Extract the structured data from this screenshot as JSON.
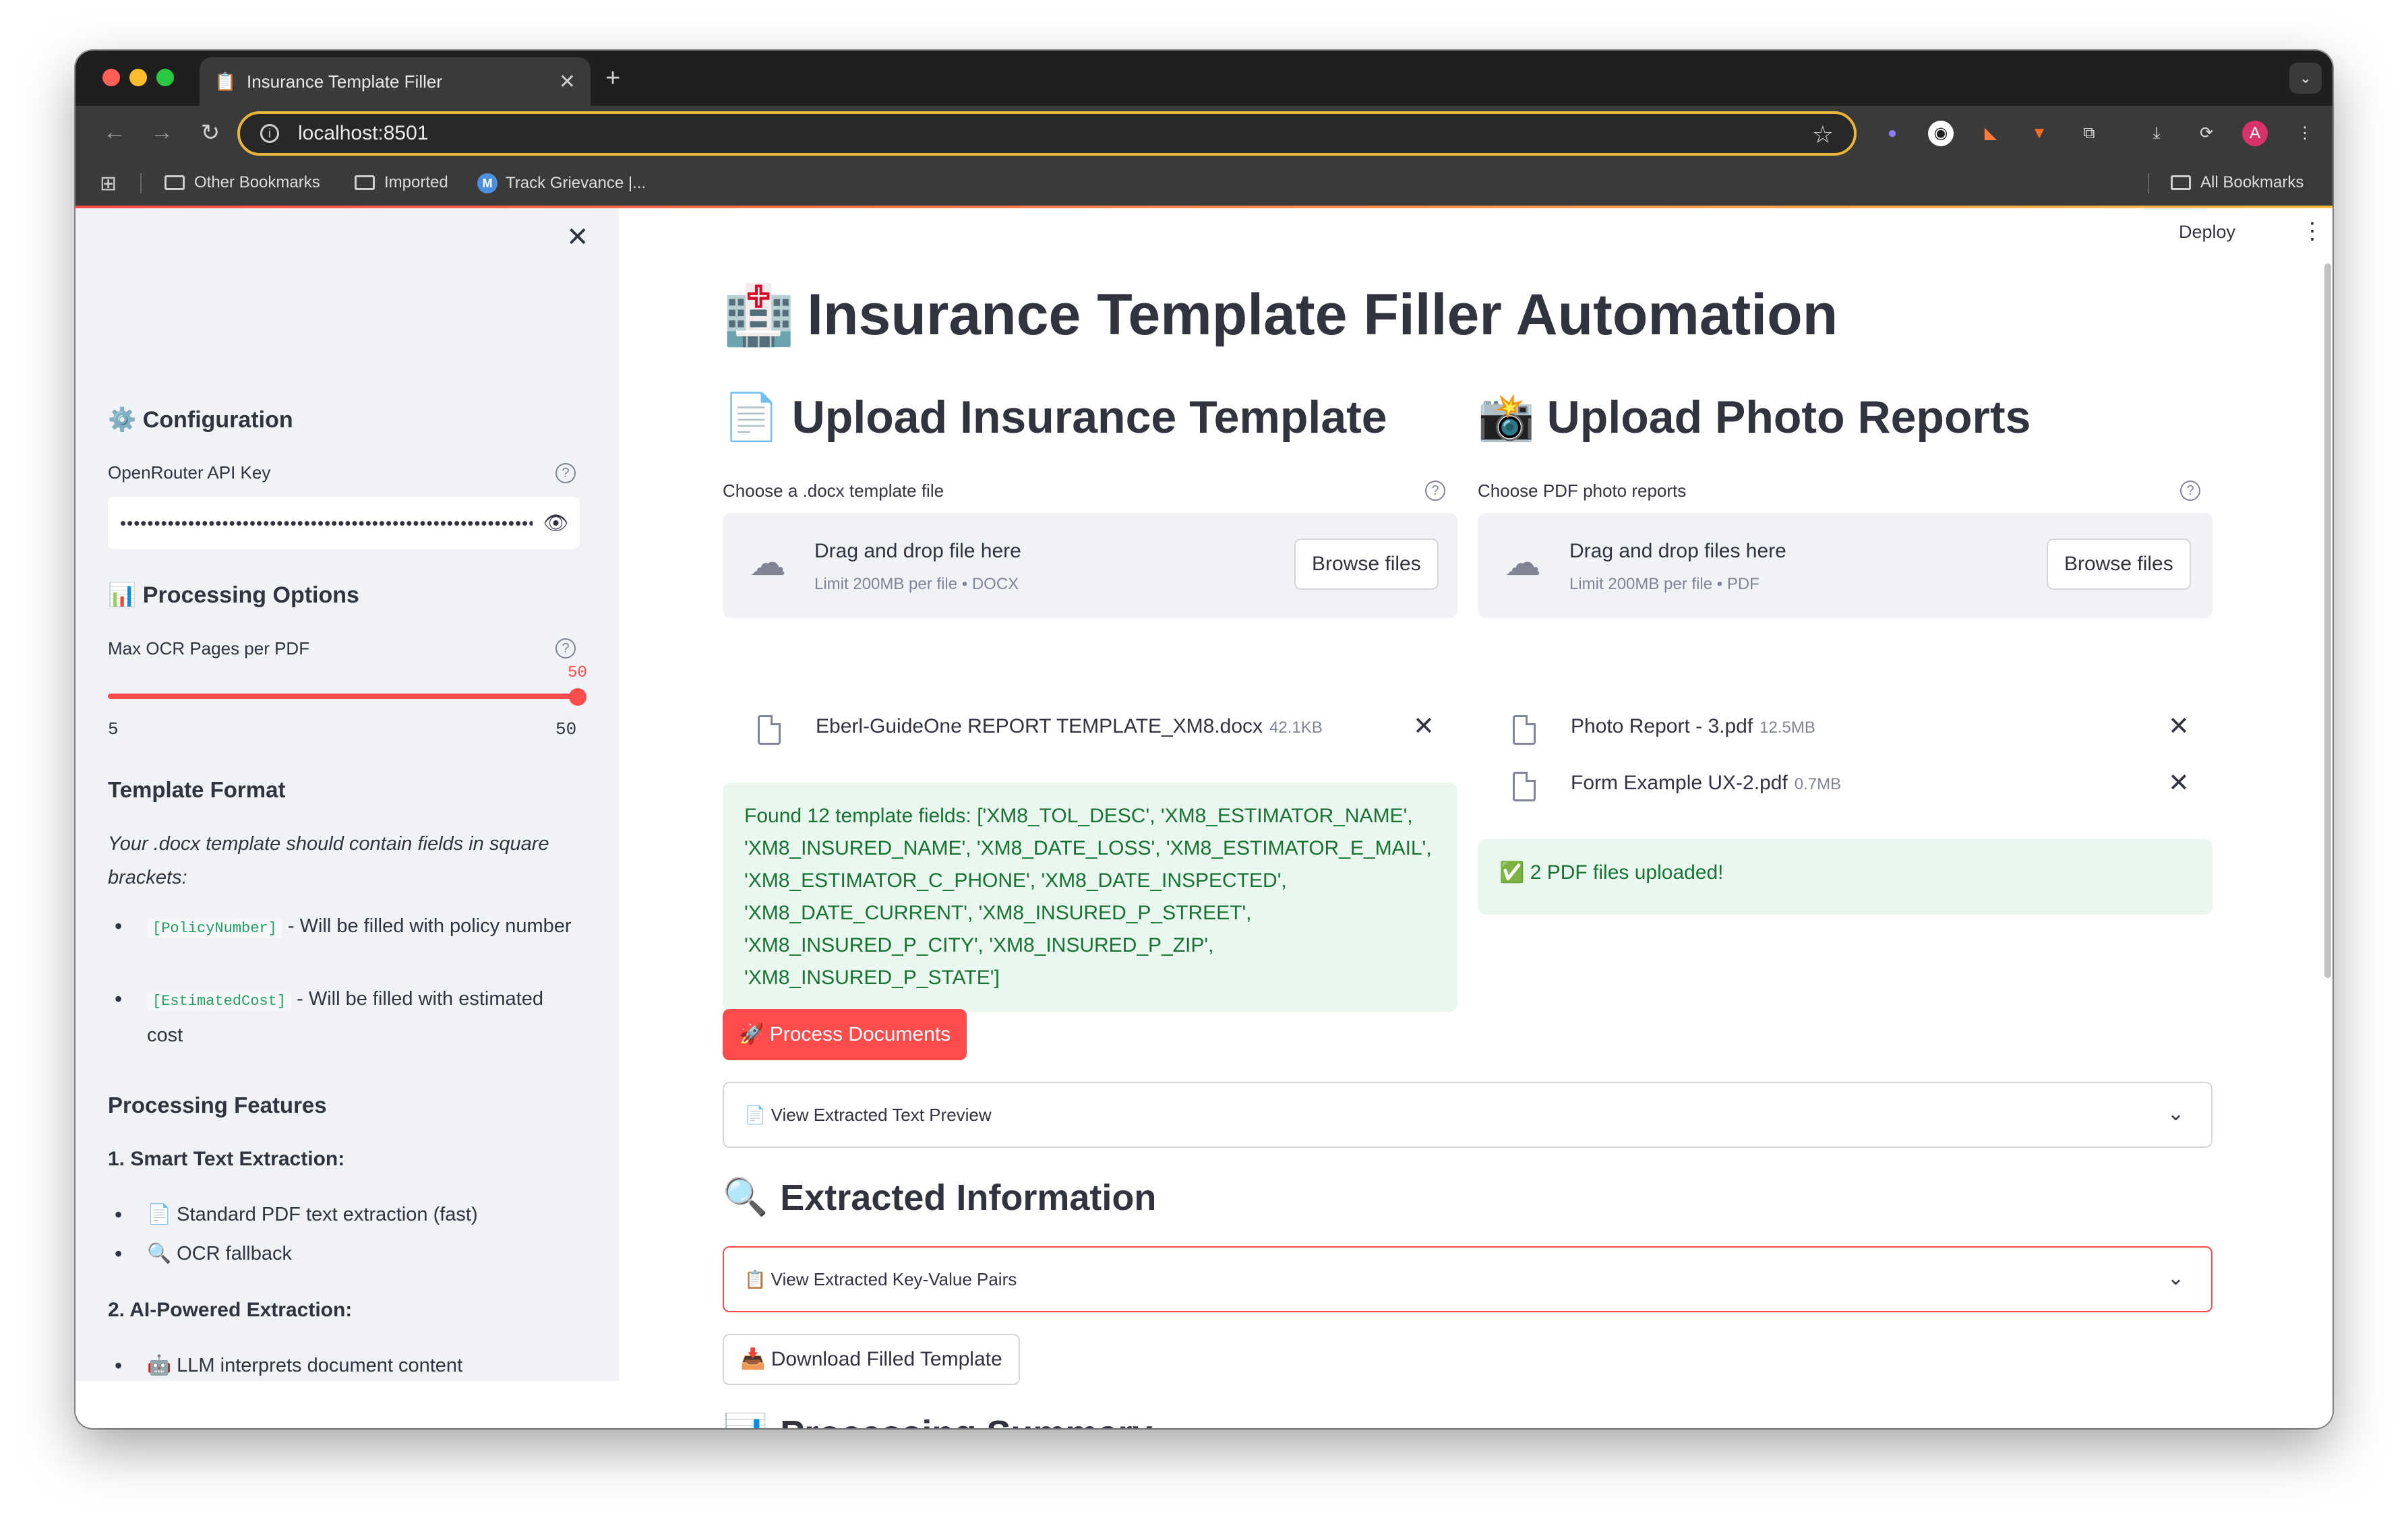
{
  "browser": {
    "tab_title": "Insurance Template Filler",
    "tab_favicon": "📋",
    "url": "localhost:8501",
    "bookmarks": [
      "Other Bookmarks",
      "Imported",
      "Track Grievance |..."
    ],
    "all_bookmarks": "All Bookmarks",
    "profile_initial": "A"
  },
  "app": {
    "deploy_label": "Deploy",
    "title_emoji": "🏥",
    "title": "Insurance Template Filler Automation"
  },
  "sidebar": {
    "config_heading": "⚙️ Configuration",
    "api_key_label": "OpenRouter API Key",
    "api_key_value": "••••••••••••••••••••••••••••••••••••••••••••••••••••••••••••••••••••••",
    "processing_heading": "📊 Processing Options",
    "slider_label": "Max OCR Pages per PDF",
    "slider_value": "50",
    "slider_min": "5",
    "slider_max": "50",
    "slider_fraction": 1.0,
    "template_format_heading": "Template Format",
    "template_format_text": "Your .docx template should contain fields in square brackets:",
    "template_items": [
      {
        "code": "[PolicyNumber]",
        "text": " - Will be filled with policy number"
      },
      {
        "code": "[EstimatedCost]",
        "text": " - Will be filled with estimated cost"
      }
    ],
    "features_heading": "Processing Features",
    "feature1_heading": "1. Smart Text Extraction:",
    "feature1_items": [
      "📄 Standard PDF text extraction (fast)",
      "🔍 OCR fallback"
    ],
    "feature2_heading": "2. AI-Powered Extraction:",
    "feature2_items": [
      "🤖 LLM interprets document content"
    ]
  },
  "upload_template": {
    "emoji": "📄",
    "heading": "Upload Insurance Template",
    "label": "Choose a .docx template file",
    "drop_title": "Drag and drop file here",
    "drop_sub": "Limit 200MB per file • DOCX",
    "browse": "Browse files",
    "files": [
      {
        "name": "Eberl-GuideOne REPORT TEMPLATE_XM8.docx",
        "size": "42.1KB"
      }
    ],
    "found_message": "Found 12 template fields: ['XM8_TOL_DESC', 'XM8_ESTIMATOR_NAME', 'XM8_INSURED_NAME', 'XM8_DATE_LOSS', 'XM8_ESTIMATOR_E_MAIL', 'XM8_ESTIMATOR_C_PHONE', 'XM8_DATE_INSPECTED', 'XM8_DATE_CURRENT', 'XM8_INSURED_P_STREET', 'XM8_INSURED_P_CITY', 'XM8_INSURED_P_ZIP', 'XM8_INSURED_P_STATE']"
  },
  "upload_photos": {
    "emoji": "📸",
    "heading": "Upload Photo Reports",
    "label": "Choose PDF photo reports",
    "drop_title": "Drag and drop files here",
    "drop_sub": "Limit 200MB per file • PDF",
    "browse": "Browse files",
    "files": [
      {
        "name": "Photo Report - 3.pdf",
        "size": "12.5MB"
      },
      {
        "name": "Form Example UX-2.pdf",
        "size": "0.7MB"
      }
    ],
    "success_message": "✅ 2 PDF files uploaded!"
  },
  "actions": {
    "process_button": "🚀 Process Documents",
    "text_preview_expander": "📄 View Extracted Text Preview",
    "extracted_heading_emoji": "🔍",
    "extracted_heading": "Extracted Information",
    "kv_expander": "📋 View Extracted Key-Value Pairs",
    "download_button": "📥 Download Filled Template",
    "summary_emoji": "📊",
    "summary_heading": "Processing Summary"
  }
}
